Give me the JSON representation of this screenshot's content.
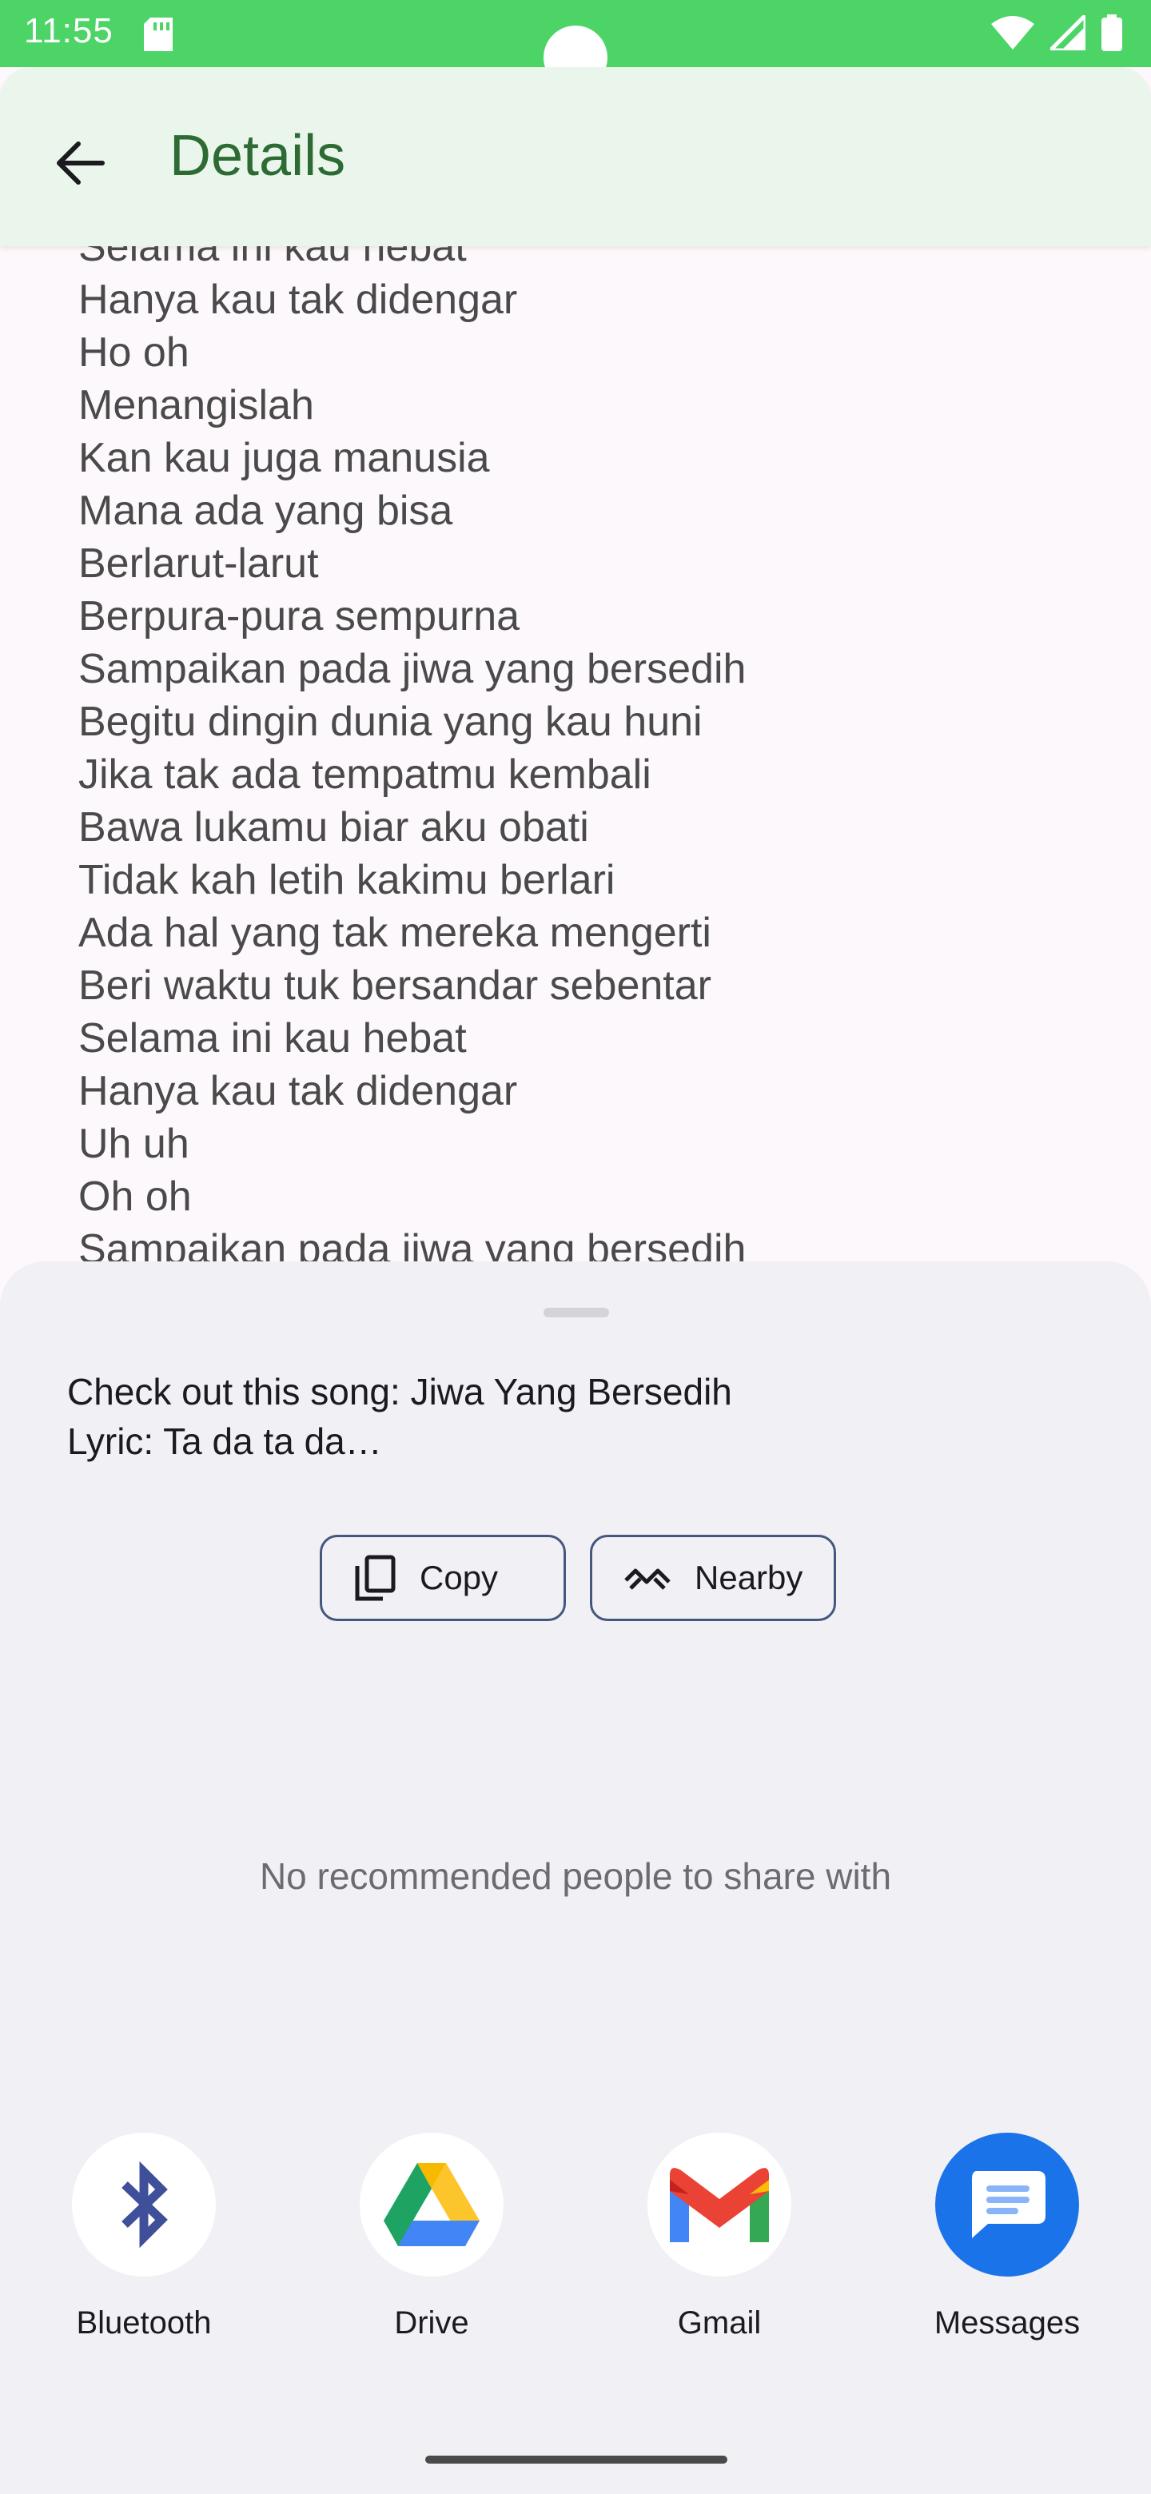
{
  "status_bar": {
    "time": "11:55"
  },
  "app_bar": {
    "title": "Details"
  },
  "lyrics": [
    "Selama ini kau hebat",
    "Hanya kau tak didengar",
    "Ho oh",
    "Menangislah",
    "Kan kau juga manusia",
    "Mana ada yang bisa",
    "Berlarut-larut",
    "Berpura-pura sempurna",
    "Sampaikan pada jiwa yang bersedih",
    "Begitu dingin dunia yang kau huni",
    "Jika tak ada tempatmu kembali",
    "Bawa lukamu biar aku obati",
    "Tidak kah letih kakimu berlari",
    "Ada hal yang tak mereka mengerti",
    "Beri waktu tuk bersandar sebentar",
    "Selama ini kau hebat",
    "Hanya kau tak didengar",
    "Uh uh",
    "Oh oh",
    "Sampaikan pada jiwa yang bersedih"
  ],
  "share_sheet": {
    "text": "Check out this song: Jiwa Yang Bersedih\nLyric: Ta da ta da…",
    "copy_label": "Copy",
    "nearby_label": "Nearby",
    "no_people": "No recommended people to share with",
    "apps": [
      {
        "label": "Bluetooth",
        "icon": "bluetooth-icon"
      },
      {
        "label": "Drive",
        "icon": "drive-icon"
      },
      {
        "label": "Gmail",
        "icon": "gmail-icon"
      },
      {
        "label": "Messages",
        "icon": "messages-icon"
      }
    ]
  }
}
